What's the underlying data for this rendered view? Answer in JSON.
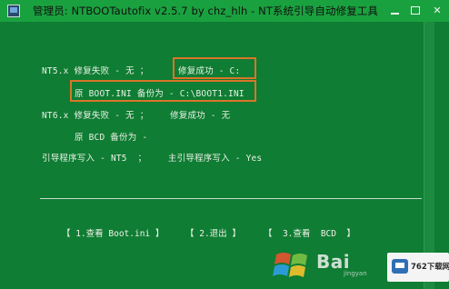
{
  "window": {
    "title": "管理员:  NTBOOTautofix v2.5.7 by chz_hlh - NT系统引导自动修复工具"
  },
  "console": {
    "nt5_line": "NT5.x 修复失败 - 无 ；",
    "nt5_success": "修复成功 - C:",
    "backup_line": "原 BOOT.INI 备份为 - C:\\BOOT1.INI",
    "nt6_line": "NT6.x 修复失败 - 无 ；    修复成功 - 无",
    "bcd_line": "原 BCD 备份为 -",
    "boot_line": "引导程序写入 - NT5  ；    主引导程序写入 - Yes"
  },
  "menu": {
    "btn1": "【 1.查看 Boot.ini 】",
    "btn2": "【 2.退出 】",
    "btn3": "【  3.查看  BCD  】"
  },
  "watermark": {
    "baidu": "Bai",
    "baidu_sub": "jingyan",
    "site": "762下载网"
  },
  "colors": {
    "console_bg": "#0f7d33",
    "titlebar": "#1aa13f",
    "highlight": "#d9752a"
  }
}
